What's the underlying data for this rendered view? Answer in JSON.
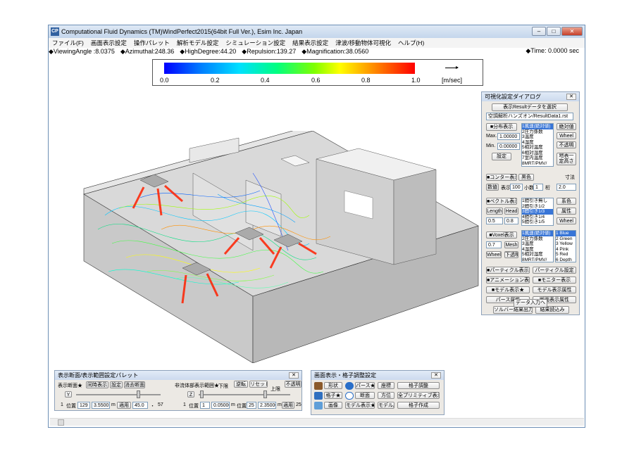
{
  "window": {
    "title": "Computational Fluid Dynamics (TM)WindPerfect2015(64bit Full Ver.), Esim Inc. Japan",
    "icon_text": "CP",
    "minimize": "–",
    "maximize": "□",
    "close": "✕"
  },
  "menu": [
    "ファイル(F)",
    "画面表示設定",
    "操作パレット",
    "解析モデル設定",
    "シミュレーション設定",
    "結果表示設定",
    "津波/移動物体可視化",
    "ヘルプ(H)"
  ],
  "info": {
    "viewing_angle": "◆ViewingAngle :8.0375",
    "azimuthal": "◆Azimuthal:248.36",
    "high_degree": "◆HighDegree:44.20",
    "repulsion": "◆Repulsion:139.27",
    "magnification": "◆Magnification:38.0560",
    "time": "◆Time: 0.0000    sec"
  },
  "legend": {
    "ticks": [
      "0.0",
      "0.2",
      "0.4",
      "0.6",
      "0.8",
      "1.0"
    ],
    "unit": "[m/sec]",
    "colors": [
      "#0000ff",
      "#00e0ff",
      "#00ff80",
      "#ffff00",
      "#ff0000"
    ]
  },
  "viz_dialog": {
    "title": "可視化設定ダイアログ",
    "select_result": "表示Resultデータを選択",
    "result_file": "空調解析ハンズオン/ResultData1.rst",
    "dist_display": "■分布表示",
    "max_label": "Max.",
    "max_value": "1.00000",
    "min_label": "Min.",
    "min_value": "0.00000",
    "settings": "設定",
    "dist_list": [
      "1風速(絶対値)",
      "2圧力係数",
      "3温度",
      "4湿度",
      "5相対温度",
      "6相対湿度",
      "7室内温度",
      "8MRT/PMV/"
    ],
    "absolute": "絶対値",
    "wheel": "Wheel",
    "opaque": "不透明",
    "above_ground": "地表一定高さ",
    "contour_display": "■コンター表示",
    "black": "黒色",
    "numeric": "数値",
    "display_label": "表示",
    "display_value": "100",
    "decimal_label": "小数",
    "decimal_value": "1",
    "digits_label": "桁",
    "size_label": "寸法",
    "size_value": "2.0",
    "vector_display": "■ベクトル表示",
    "vector_list": [
      "1間引き無し",
      "2間引き1/2",
      "3間引き1/3",
      "4間引き1/4",
      "5間引き1/5"
    ],
    "vector_selected": 2,
    "system_color": "系色",
    "length": "Length",
    "head": "Head",
    "attribute": "属性",
    "length_value": "0.5",
    "head_value": "0.8",
    "voxel_display": "■Voxel表示",
    "voxel_list": [
      "1風速(絶対値)",
      "2圧力係数",
      "3温度",
      "4湿度",
      "5相対湿度",
      "8MRT/PMV/"
    ],
    "color_list": [
      "1 Blue",
      "2 Green",
      "3 Yellow",
      "4 Pink",
      "5 Red",
      "6 Depth"
    ],
    "voxel_value": "0.7",
    "mesh": "Mesh",
    "wheel2": "Wheel",
    "translucent": "下透明",
    "particle_display": "■パーティクル表示★",
    "particle_settings": "パーティクル設定",
    "animation_display": "■アニメーション表示",
    "monitor_display": "■モニター表示",
    "model_display": "■モデル表示★",
    "model_attr": "モデル表示属性",
    "perspective_attr": "パース属性",
    "section_attr": "断面表示属性",
    "solver_output": "ソルバー結果出力",
    "load_result": "結果読込み",
    "data_input": "データ入力へ"
  },
  "section_dialog": {
    "title": "表示断面/表示範囲設定パレット",
    "section_label": "表示断面★",
    "simultaneous": "同時表示",
    "settings": "設定",
    "delete_section": "消去断面",
    "fluid_range": "非流体部表示範囲★",
    "lower": "下限",
    "reverse": "逆転",
    "reset": "リセット",
    "upper": "上限",
    "opaque": "不透明",
    "axis_y": "Y",
    "axis_z": "Z",
    "row1_no": "1",
    "row1_pos_label": "位置",
    "row1_pos": "129",
    "row1_val": "3.5500",
    "row1_unit": "m",
    "apply": "適用",
    "angle": "45.0",
    "angle_sep": "・",
    "angle2": "57",
    "row2_no": "1",
    "row2_pos_label": "位置",
    "row2_pos": "1",
    "row2_val": "0.05000",
    "row2_unit": "m",
    "row2_pos_label2": "位置",
    "row2_pos2": "25",
    "row2_val2": "2.35000",
    "row2_unit2": "m",
    "apply2": "適用",
    "row2_end": "25"
  },
  "mesh_dialog": {
    "title": "画面表示・格子調整設定",
    "shape": "形状",
    "perspective": "パース★",
    "coords": "座標",
    "grid_adjust": "格子調整",
    "grid": "格子★",
    "section": "断面",
    "direction": "方位",
    "all_display": "全プリミティブ表示★",
    "image": "画像",
    "model_display": "モデル表示★",
    "model_attr": "モデル属性",
    "grid_create": "格子作成"
  }
}
